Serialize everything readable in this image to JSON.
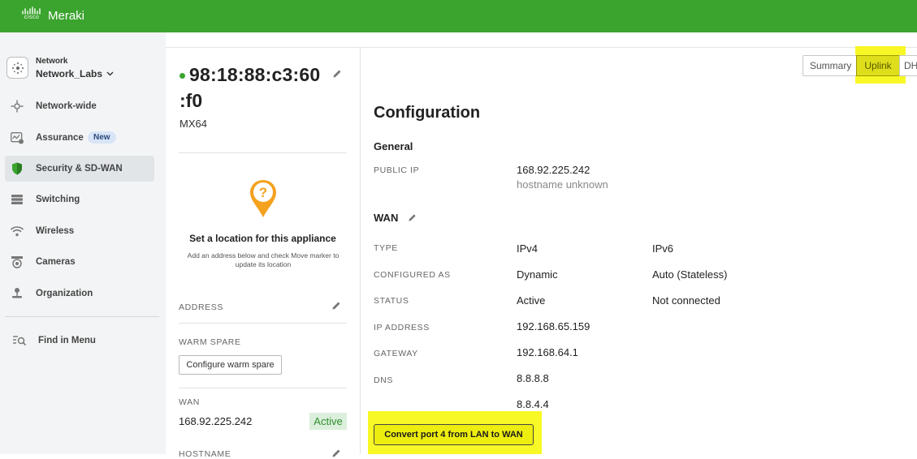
{
  "app": {
    "brand_small": "cisco",
    "brand_name": "Meraki",
    "accent_color": "#3ba42e",
    "highlight_color": "#f7f700"
  },
  "sidebar": {
    "network_label": "Network",
    "network_name": "Network_Labs",
    "items": [
      {
        "label": "Network-wide",
        "icon": "network-wide-icon"
      },
      {
        "label": "Assurance",
        "icon": "assurance-icon",
        "badge": "New"
      },
      {
        "label": "Security & SD-WAN",
        "icon": "shield-icon",
        "active": true
      },
      {
        "label": "Switching",
        "icon": "switch-icon"
      },
      {
        "label": "Wireless",
        "icon": "wifi-icon"
      },
      {
        "label": "Cameras",
        "icon": "camera-icon"
      },
      {
        "label": "Organization",
        "icon": "organization-icon"
      }
    ],
    "find_label": "Find in Menu"
  },
  "device": {
    "mac_line1": "98:18:88:c3:60",
    "mac_line2": ":f0",
    "model": "MX64",
    "status_color": "#3ba42e",
    "location_title": "Set a location for this appliance",
    "location_sub": "Add an address below and check Move marker to update its location",
    "address_label": "ADDRESS",
    "warm_spare_label": "WARM SPARE",
    "warm_spare_button": "Configure warm spare",
    "wan_label": "WAN",
    "wan_ip": "168.92.225.242",
    "wan_status": "Active",
    "hostname_label": "HOSTNAME"
  },
  "tabs": [
    {
      "label": "Summary"
    },
    {
      "label": "Uplink",
      "active": true
    },
    {
      "label": "DHCP"
    }
  ],
  "config": {
    "title": "Configuration",
    "general_title": "General",
    "public_ip_label": "PUBLIC IP",
    "public_ip": "168.92.225.242",
    "hostname_note": "hostname unknown",
    "wan_title": "WAN",
    "rows": [
      {
        "label": "TYPE",
        "v1": "IPv4",
        "v2": "IPv6"
      },
      {
        "label": "CONFIGURED AS",
        "v1": "Dynamic",
        "v2": "Auto (Stateless)"
      },
      {
        "label": "STATUS",
        "v1": "Active",
        "v2": "Not connected"
      },
      {
        "label": "IP ADDRESS",
        "v1": "192.168.65.159",
        "v2": ""
      },
      {
        "label": "GATEWAY",
        "v1": "192.168.64.1",
        "v2": ""
      },
      {
        "label": "DNS",
        "v1": "8.8.8.8",
        "v2": ""
      },
      {
        "label": "",
        "v1": "8.8.4.4",
        "v2": ""
      }
    ],
    "convert_button": "Convert port 4 from LAN to WAN"
  }
}
